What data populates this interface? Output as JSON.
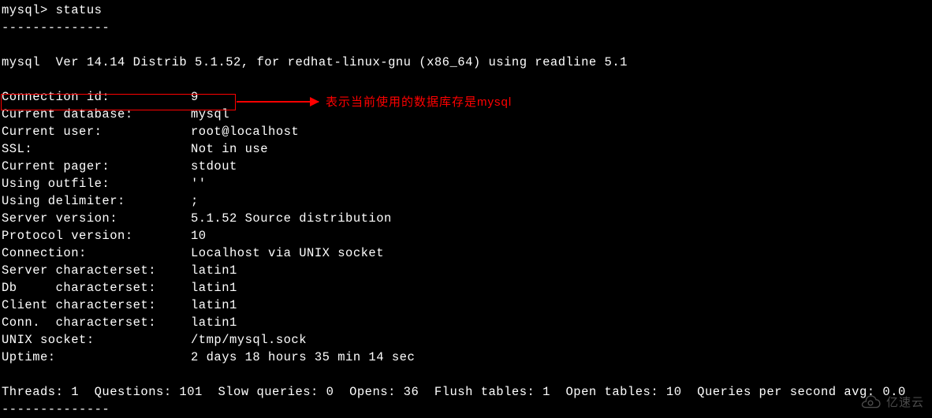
{
  "prompt": "mysql> status",
  "dashline1": "--------------",
  "version_line": "mysql  Ver 14.14 Distrib 5.1.52, for redhat-linux-gnu (x86_64) using readline 5.1",
  "rows": [
    {
      "label": "Connection id:",
      "value": "9"
    },
    {
      "label": "Current database:",
      "value": "mysql"
    },
    {
      "label": "Current user:",
      "value": "root@localhost"
    },
    {
      "label": "SSL:",
      "value": "Not in use"
    },
    {
      "label": "Current pager:",
      "value": "stdout"
    },
    {
      "label": "Using outfile:",
      "value": "''"
    },
    {
      "label": "Using delimiter:",
      "value": ";"
    },
    {
      "label": "Server version:",
      "value": "5.1.52 Source distribution"
    },
    {
      "label": "Protocol version:",
      "value": "10"
    },
    {
      "label": "Connection:",
      "value": "Localhost via UNIX socket"
    },
    {
      "label": "Server characterset:",
      "value": "latin1"
    },
    {
      "label": "Db     characterset:",
      "value": "latin1"
    },
    {
      "label": "Client characterset:",
      "value": "latin1"
    },
    {
      "label": "Conn.  characterset:",
      "value": "latin1"
    },
    {
      "label": "UNIX socket:",
      "value": "/tmp/mysql.sock"
    },
    {
      "label": "Uptime:",
      "value": "2 days 18 hours 35 min 14 sec"
    }
  ],
  "stats_line": "Threads: 1  Questions: 101  Slow queries: 0  Opens: 36  Flush tables: 1  Open tables: 10  Queries per second avg: 0.0",
  "dashline2": "--------------",
  "annotation": "表示当前使用的数据库存是mysql",
  "watermark_text": "亿速云"
}
